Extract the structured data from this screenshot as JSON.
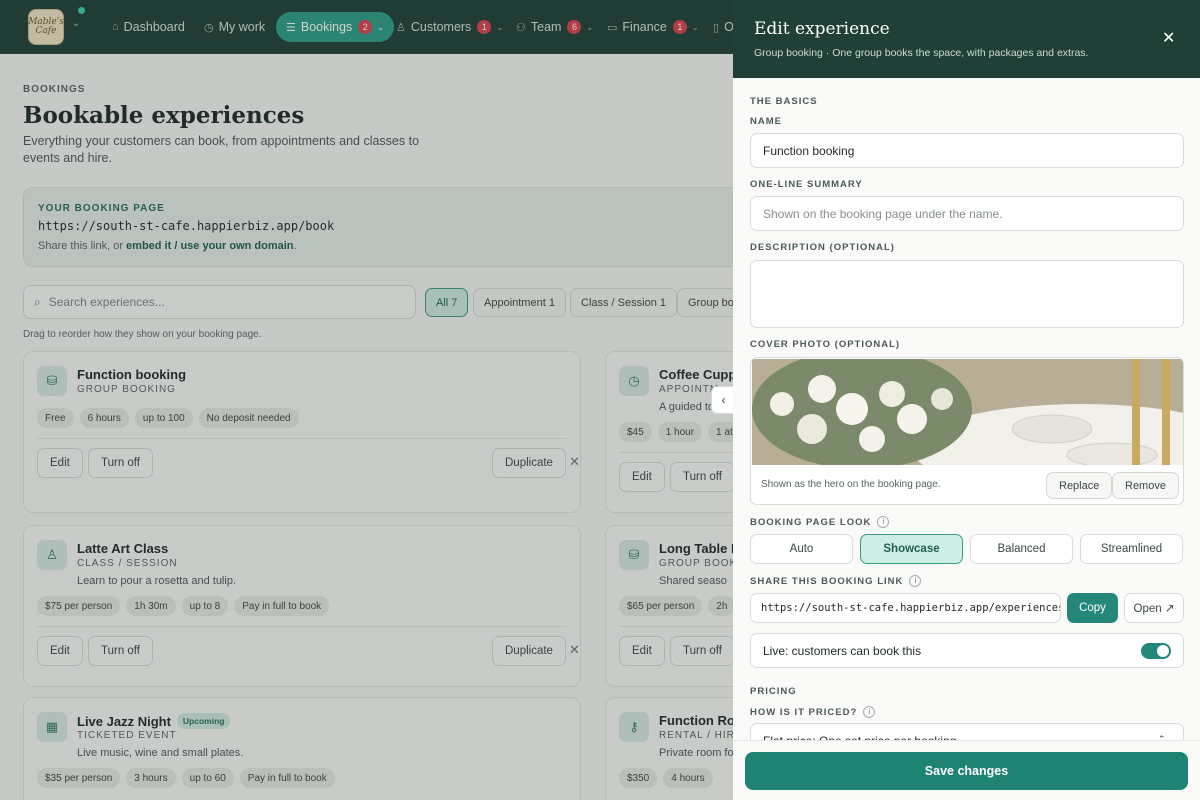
{
  "nav": {
    "logo_text": "Mable's Cafe",
    "items": [
      {
        "label": "Dashboard",
        "icon": "home-icon",
        "badge": null,
        "chevron": false,
        "active": false
      },
      {
        "label": "My work",
        "icon": "clock-icon",
        "badge": null,
        "chevron": false,
        "active": false
      },
      {
        "label": "Bookings",
        "icon": "list-icon",
        "badge": "2",
        "chevron": true,
        "active": true
      },
      {
        "label": "Customers",
        "icon": "people-icon",
        "badge": "1",
        "chevron": true,
        "active": false
      },
      {
        "label": "Team",
        "icon": "team-icon",
        "badge": "6",
        "chevron": true,
        "active": false
      },
      {
        "label": "Finance",
        "icon": "card-icon",
        "badge": "1",
        "chevron": true,
        "active": false
      },
      {
        "label": "O",
        "icon": "phone-icon",
        "badge": null,
        "chevron": false,
        "active": false
      }
    ]
  },
  "page": {
    "eyebrow": "BOOKINGS",
    "title": "Bookable experiences",
    "lede": "Everything your customers can book, from appointments and classes to events and hire."
  },
  "booking_page": {
    "label": "YOUR BOOKING PAGE",
    "url": "https://south-st-cafe.happierbiz.app/book",
    "note_prefix": "Share this link, or ",
    "note_link": "embed it / use your own domain",
    "note_suffix": "."
  },
  "search": {
    "placeholder": "Search experiences..."
  },
  "filters": [
    {
      "label": "All 7",
      "active": true
    },
    {
      "label": "Appointment 1",
      "active": false
    },
    {
      "label": "Class / Session 1",
      "active": false
    },
    {
      "label": "Group boo",
      "active": false
    }
  ],
  "drag_note": "Drag to reorder how they show on your booking page.",
  "cards": [
    {
      "title": "Function booking",
      "type": "GROUP BOOKING",
      "desc": "",
      "tag": "",
      "icon": "cake-icon",
      "pills": [
        "Free",
        "6 hours",
        "up to 100",
        "No deposit needed"
      ],
      "actions": [
        "Edit",
        "Turn off",
        "Duplicate"
      ]
    },
    {
      "title": "Coffee Cupp",
      "type": "APPOINTM",
      "desc": "A guided to",
      "tag": "",
      "icon": "clock-icon",
      "pills": [
        "$45",
        "1 hour",
        "1 at"
      ],
      "actions": [
        "Edit",
        "Turn off"
      ]
    },
    {
      "title": "Latte Art Class",
      "type": "CLASS / SESSION",
      "desc": "Learn to pour a rosetta and tulip.",
      "tag": "",
      "icon": "people-icon",
      "pills": [
        "$75 per person",
        "1h 30m",
        "up to 8",
        "Pay in full to book"
      ],
      "actions": [
        "Edit",
        "Turn off",
        "Duplicate"
      ]
    },
    {
      "title": "Long Table L",
      "type": "GROUP BOOKI",
      "desc": "Shared seaso",
      "tag": "",
      "icon": "cake-icon",
      "pills": [
        "$65 per person",
        "2h"
      ],
      "actions": [
        "Edit",
        "Turn off"
      ]
    },
    {
      "title": "Live Jazz Night",
      "type": "TICKETED EVENT",
      "desc": "Live music, wine and small plates.",
      "tag": "Upcoming",
      "icon": "calendar-icon",
      "pills": [
        "$35 per person",
        "3 hours",
        "up to 60",
        "Pay in full to book"
      ],
      "actions": []
    },
    {
      "title": "Function Roo",
      "type": "RENTAL / HIRE",
      "desc": "Private room fo",
      "tag": "",
      "icon": "key-icon",
      "pills": [
        "$350",
        "4 hours"
      ],
      "actions": []
    }
  ],
  "drawer": {
    "title": "Edit experience",
    "subtitle": "Group booking · One group books the space, with packages and extras.",
    "basics_label": "THE BASICS",
    "name_label": "NAME",
    "name_value": "Function booking",
    "summary_label": "ONE-LINE SUMMARY",
    "summary_placeholder": "Shown on the booking page under the name.",
    "description_label": "DESCRIPTION (OPTIONAL)",
    "cover_label": "COVER PHOTO (OPTIONAL)",
    "cover_caption": "Shown as the hero on the booking page.",
    "replace_label": "Replace",
    "remove_label": "Remove",
    "look_label": "BOOKING PAGE LOOK",
    "looks": [
      {
        "label": "Auto",
        "active": false
      },
      {
        "label": "Showcase",
        "active": true
      },
      {
        "label": "Balanced",
        "active": false
      },
      {
        "label": "Streamlined",
        "active": false
      }
    ],
    "share_label": "SHARE THIS BOOKING LINK",
    "share_url": "https://south-st-cafe.happierbiz.app/experiences/function-booking",
    "copy_label": "Copy",
    "open_label": "Open ↗",
    "live_label": "Live: customers can book this",
    "live_on": true,
    "pricing_label": "PRICING",
    "priced_label": "HOW IS IT PRICED?",
    "priced_value": "Flat price: One set price per booking",
    "save_label": "Save changes"
  },
  "colors": {
    "nav_bg": "#1f3f37",
    "accent": "#23887a",
    "badge": "#d9414e",
    "active_chip": "#cde8df"
  }
}
